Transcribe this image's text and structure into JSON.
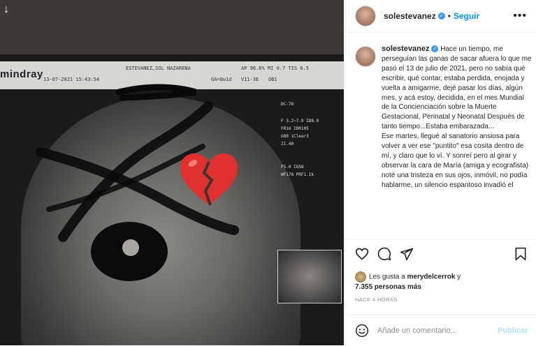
{
  "post": {
    "photo": {
      "header": {
        "brand": "mindray",
        "patient": "ESTEVANEZ,SOL NAZARENA",
        "readout": "AP 96.6%  MI 0.7  TIS 0.5",
        "datetime": "13-07-2021 15:43:54",
        "ga": "GA=8w1d",
        "probe": "V11-3E",
        "ob": "OB1"
      },
      "side_panel": [
        "DC-78",
        "F 3.2~7.9  ID8.0",
        "FR16  IDR105",
        "G80  iClear3",
        "Z1.40",
        "F5.0  IG58",
        "WF178  PRF1.1k"
      ],
      "sticker": "broken-heart-emoji"
    },
    "author": {
      "username": "solestevanez",
      "verified_icon": "verified-badge-icon",
      "follow_label": "Seguir"
    },
    "caption": {
      "username": "solestevanez",
      "paragraphs": [
        "Hace un tiempo, me perseguían las ganas de sacar afuera lo que me pasó el 13 de julio de 2021, pero no sabía qué escribir, qué contar, estaba perdida, enojada y vuelta a amigarme, dejé pasar los días, algún mes, y acá estoy, decidida, en el mes Mundial de la Concienciación sobre la Muerte Gestacional, Perinatal y Neonatal Después de tanto tiempo...Estaba embarazada...",
        "Ese martes, llegué al sanatorio ansiosa para volver a ver ese \"puntito\" esa cosita dentro de mí, y claro que lo ví. Y sonreí pero al girar y observar la cara de María (amiga y ecografista) noté una tristeza en sus ojos, inmóvil, no podía hablarme, un silencio espantoso invadió el"
      ]
    },
    "likes": {
      "prefix": "Les gusta a",
      "user": "merydelcerrok",
      "connector": "y",
      "count": "7.355 personas más"
    },
    "timestamp": "HACE 4 HORAS",
    "comment": {
      "placeholder": "Añade un comentario...",
      "publish_label": "Publicar"
    },
    "colors": {
      "link_blue": "#0095f6",
      "verified_blue": "#3897f0",
      "publish_disabled": "#b2dffc",
      "meta_gray": "#8e8e8e"
    }
  }
}
